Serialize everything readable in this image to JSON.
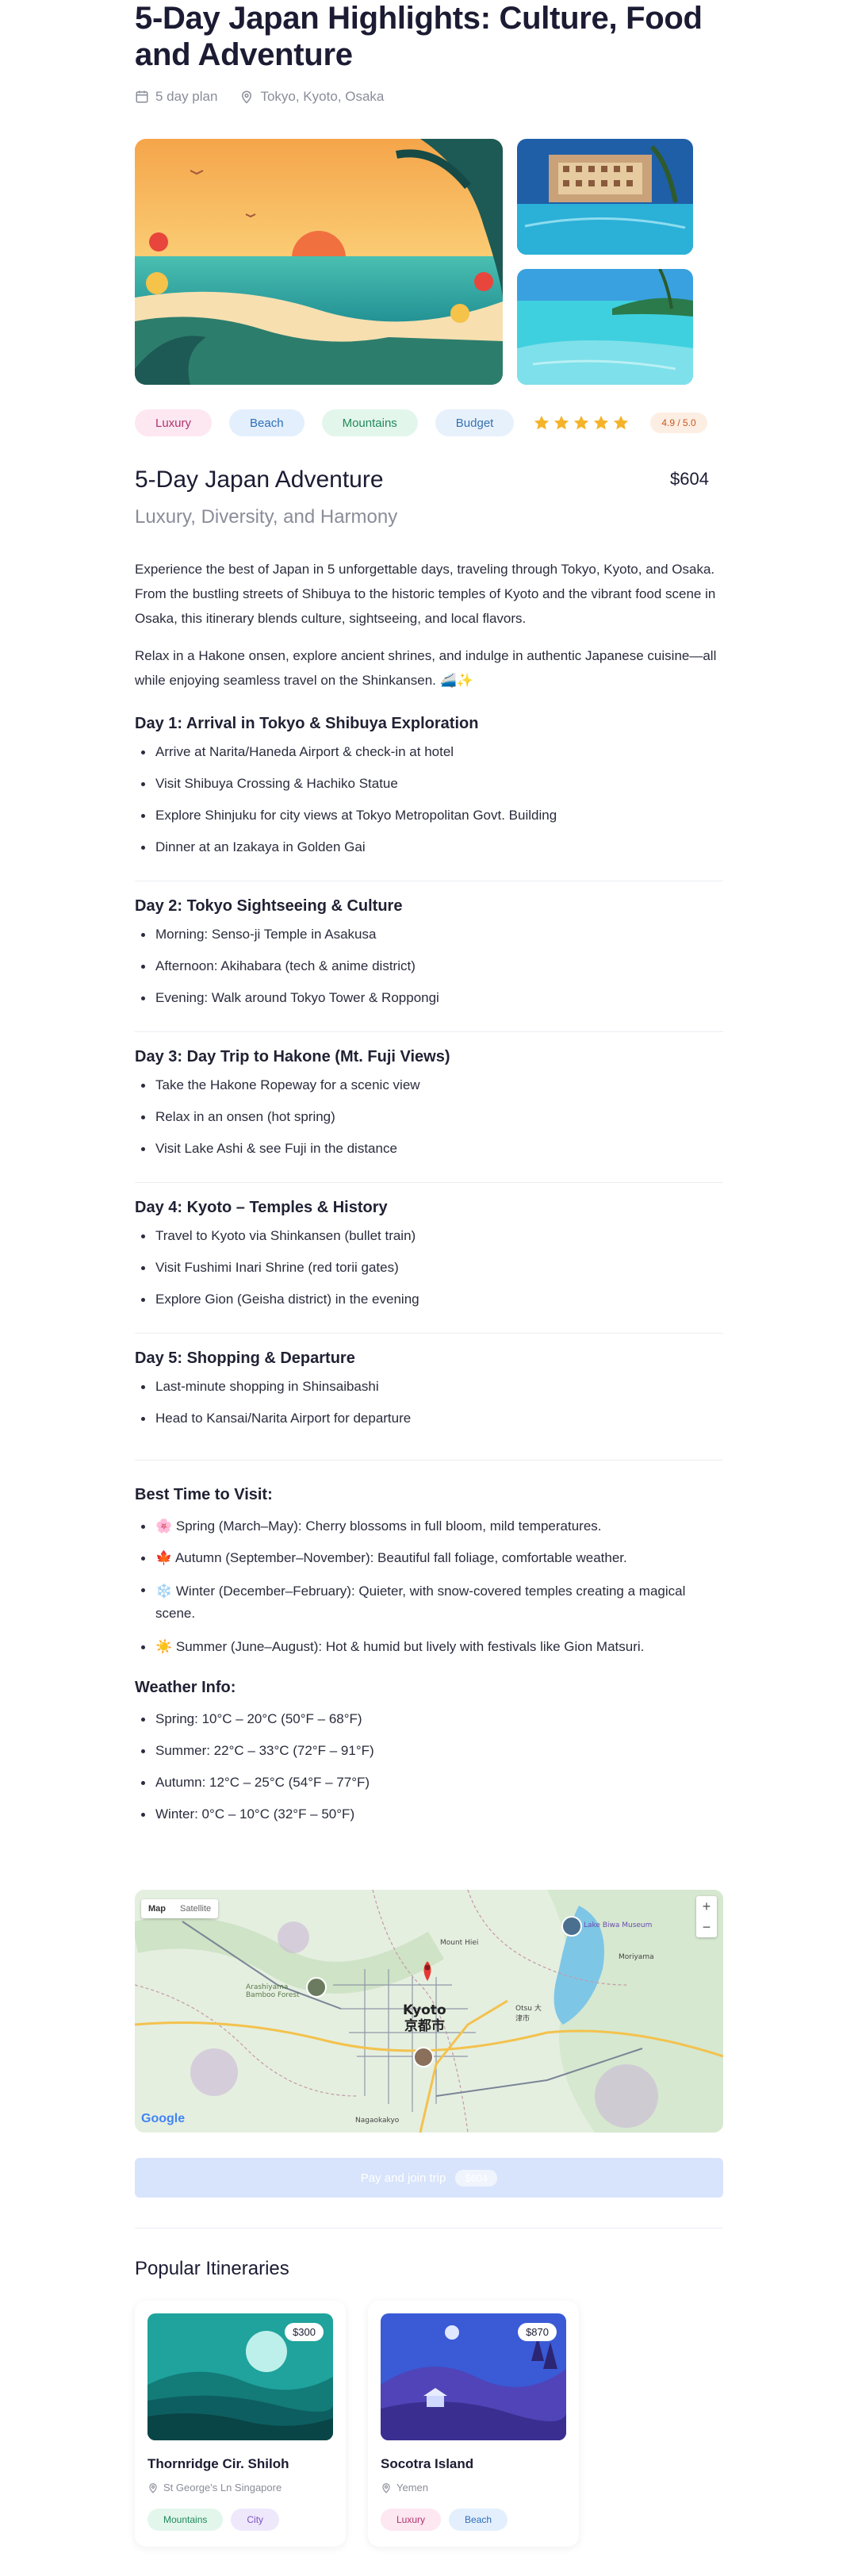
{
  "trip": {
    "title": "5-Day Japan Highlights: Culture, Food and Adventure",
    "plan": "5 day plan",
    "cities": "Tokyo, Kyoto, Osaka"
  },
  "tags": [
    "Luxury",
    "Beach",
    "Mountains",
    "Budget"
  ],
  "rating": {
    "stars": 5,
    "label": "4.9 / 5.0"
  },
  "overview": {
    "heading": "5-Day Japan Adventure",
    "price": "$604",
    "subtitle": "Luxury, Diversity, and Harmony",
    "para1": "Experience the best of Japan in 5 unforgettable days, traveling through Tokyo, Kyoto, and Osaka. From the bustling streets of Shibuya to the historic temples of Kyoto and the vibrant food scene in Osaka, this itinerary blends culture, sightseeing, and local flavors.",
    "para2": "Relax in a Hakone onsen, explore ancient shrines, and indulge in authentic Japanese cuisine—all while enjoying seamless travel on the Shinkansen. 🚄✨"
  },
  "days": [
    {
      "title": "Day 1: Arrival in Tokyo & Shibuya Exploration",
      "items": [
        "Arrive at Narita/Haneda Airport & check-in at hotel",
        "Visit Shibuya Crossing & Hachiko Statue",
        "Explore Shinjuku for city views at Tokyo Metropolitan Govt. Building",
        "Dinner at an Izakaya in Golden Gai"
      ]
    },
    {
      "title": "Day 2: Tokyo Sightseeing & Culture",
      "items": [
        "Morning: Senso-ji Temple in Asakusa",
        "Afternoon: Akihabara (tech & anime district)",
        "Evening: Walk around Tokyo Tower & Roppongi"
      ]
    },
    {
      "title": "Day 3: Day Trip to Hakone (Mt. Fuji Views)",
      "items": [
        "Take the Hakone Ropeway for a scenic view",
        "Relax in an onsen (hot spring)",
        "Visit Lake Ashi & see Fuji in the distance"
      ]
    },
    {
      "title": "Day 4: Kyoto – Temples & History",
      "items": [
        "Travel to Kyoto via Shinkansen (bullet train)",
        "Visit Fushimi Inari Shrine (red torii gates)",
        "Explore Gion (Geisha district) in the evening"
      ]
    },
    {
      "title": "Day 5: Shopping & Departure",
      "items": [
        "Last-minute shopping in Shinsaibashi",
        "Head to Kansai/Narita Airport for departure"
      ]
    }
  ],
  "best_time": {
    "title": "Best Time to Visit:",
    "items": [
      "🌸 Spring (March–May): Cherry blossoms in full bloom, mild temperatures.",
      "🍁 Autumn (September–November): Beautiful fall foliage, comfortable weather.",
      "❄️ Winter (December–February): Quieter, with snow-covered temples creating a magical scene.",
      "☀️ Summer (June–August): Hot & humid but lively with festivals like Gion Matsuri."
    ]
  },
  "weather": {
    "title": "Weather Info:",
    "items": [
      "Spring: 10°C – 20°C (50°F – 68°F)",
      "Summer: 22°C – 33°C (72°F – 91°F)",
      "Autumn: 12°C – 25°C (54°F – 77°F)",
      "Winter: 0°C – 10°C (32°F – 50°F)"
    ]
  },
  "map": {
    "map_tab": "Map",
    "satellite_tab": "Satellite",
    "city_en": "Kyoto",
    "city_jp": "京都市",
    "google": "Google",
    "labels": {
      "arashiyama": "Arashiyama Bamboo Forest",
      "mount_hiei": "Mount Hiei",
      "otsu": "Otsu 大津市",
      "lake_biwa": "Lake Biwa Museum",
      "moriyama": "Moriyama",
      "nagaokakyo": "Nagaokakyo"
    },
    "zoom_in": "+",
    "zoom_out": "−"
  },
  "pay": {
    "label": "Pay and join trip",
    "amount": "$604"
  },
  "popular": {
    "title": "Popular Itineraries",
    "cards": [
      {
        "price": "$300",
        "title": "Thornridge Cir. Shiloh",
        "location": "St George's Ln Singapore",
        "tags": [
          "Mountains",
          "City"
        ]
      },
      {
        "price": "$870",
        "title": "Socotra Island",
        "location": "Yemen",
        "tags": [
          "Luxury",
          "Beach"
        ]
      }
    ]
  },
  "colors": {
    "accent": "#f5b32a",
    "pay_button": "#d8e4fb"
  }
}
